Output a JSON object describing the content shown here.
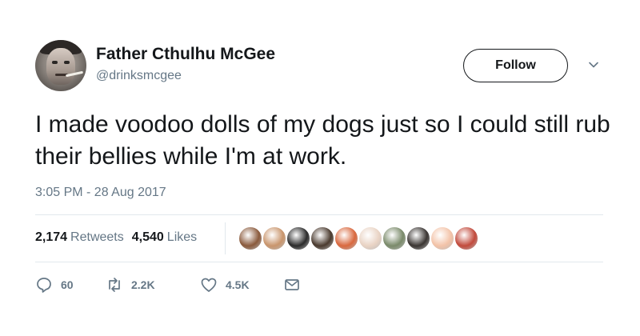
{
  "user": {
    "display_name": "Father Cthulhu McGee",
    "handle": "@drinksmcgee",
    "avatar_icon": "profile-photo"
  },
  "header": {
    "follow_label": "Follow",
    "menu_icon": "chevron-down-icon"
  },
  "tweet": {
    "text": "I made voodoo dolls of my dogs just so I could still rub their bellies while I'm at work.",
    "timestamp": "3:05 PM - 28 Aug 2017"
  },
  "stats": {
    "retweets_count": "2,174",
    "retweets_label": "Retweets",
    "likes_count": "4,540",
    "likes_label": "Likes"
  },
  "likers": [
    {
      "color": "#8a5a3c"
    },
    {
      "color": "#c9956c"
    },
    {
      "color": "#2b2b2b"
    },
    {
      "color": "#4a3a2e"
    },
    {
      "color": "#d9683e"
    },
    {
      "color": "#e9d3c4"
    },
    {
      "color": "#7a8a6a"
    },
    {
      "color": "#3a3532"
    },
    {
      "color": "#f3c3a8"
    },
    {
      "color": "#c24a3c"
    }
  ],
  "actions": {
    "reply_count": "60",
    "retweet_count": "2.2K",
    "like_count": "4.5K",
    "reply_icon": "reply-icon",
    "retweet_icon": "retweet-icon",
    "like_icon": "heart-icon",
    "dm_icon": "envelope-icon"
  },
  "colors": {
    "text": "#14171a",
    "secondary": "#657786",
    "divider": "#e1e8ed"
  }
}
